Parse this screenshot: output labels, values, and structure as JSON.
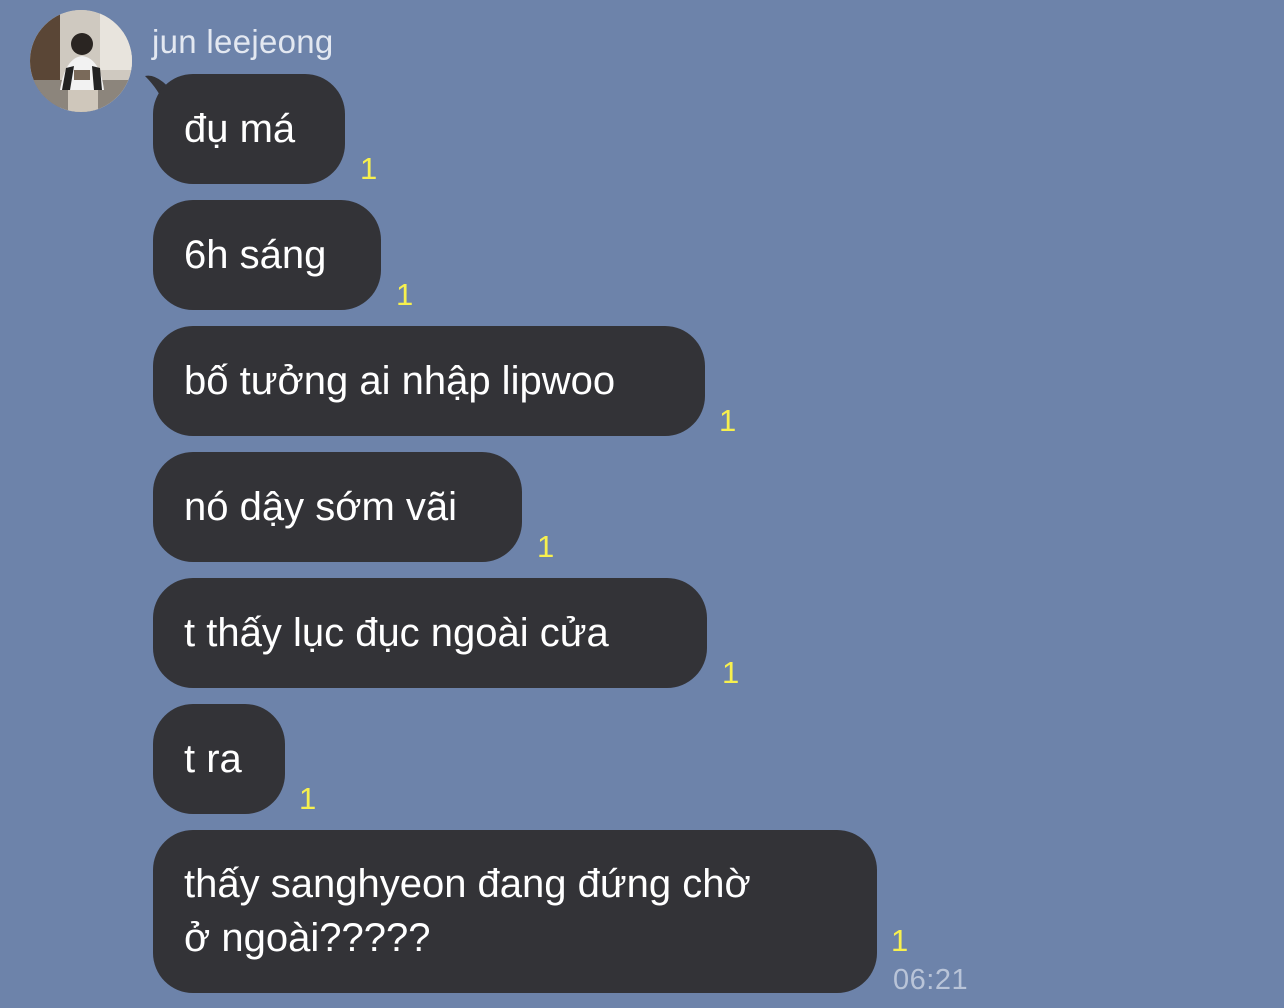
{
  "chat": {
    "sender": {
      "name": "jun leejeong",
      "avatar_icon": "profile-photo-icon"
    },
    "colors": {
      "background": "#6d83aa",
      "bubble": "#333337",
      "bubble_text": "#ffffff",
      "unread": "#f7f04e",
      "time": "#b9c4d8"
    },
    "messages": [
      {
        "text": "đụ má",
        "unread": "1"
      },
      {
        "text": "6h sáng",
        "unread": "1"
      },
      {
        "text": "bố tưởng ai nhập lipwoo",
        "unread": "1"
      },
      {
        "text": "nó dậy sớm vãi",
        "unread": "1"
      },
      {
        "text": "t thấy lục đục ngoài cửa",
        "unread": "1"
      },
      {
        "text": "t ra",
        "unread": "1"
      },
      {
        "text_line1": "thấy sanghyeon đang đứng chờ",
        "text_line2": "ở ngoài?????",
        "unread": "1",
        "time": "06:21"
      }
    ]
  }
}
